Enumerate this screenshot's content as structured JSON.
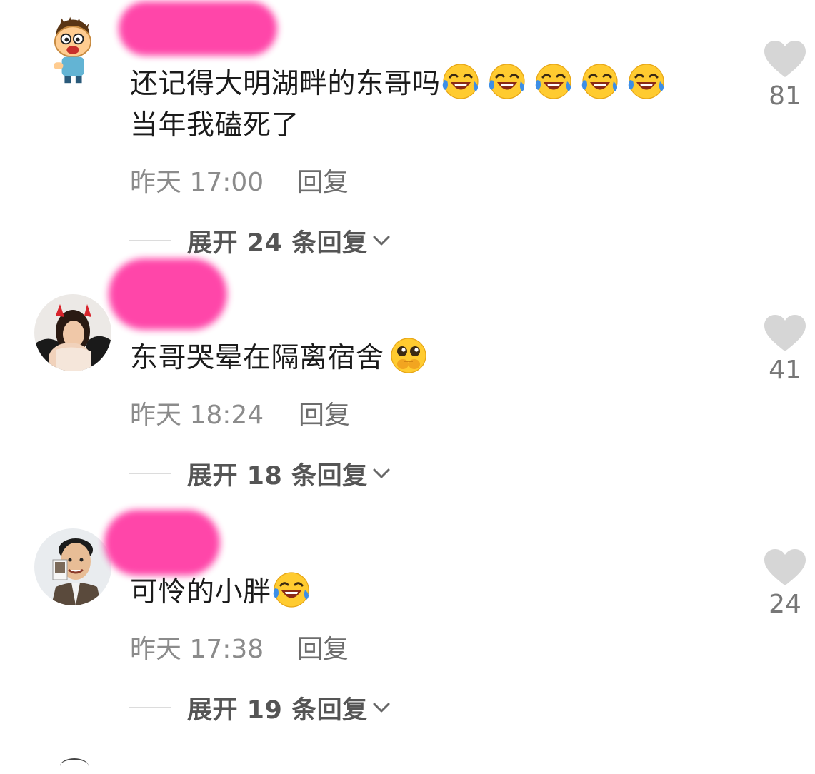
{
  "comments": [
    {
      "text_line1": "还记得大明湖畔的东哥吗",
      "text_line2": "当年我磕死了",
      "emoji": [
        "laugh-cry-emoji",
        "laugh-cry-emoji",
        "laugh-cry-emoji",
        "laugh-cry-emoji",
        "laugh-cry-emoji"
      ],
      "time": "昨天 17:00",
      "reply": "回复",
      "expand": "展开 24 条回复",
      "likes": "81"
    },
    {
      "text_line1": "东哥哭晕在隔离宿舍",
      "emoji": [
        "pleading-hands-emoji"
      ],
      "time": "昨天 18:24",
      "reply": "回复",
      "expand": "展开 18 条回复",
      "likes": "41"
    },
    {
      "text_line1": "可怜的小胖",
      "emoji": [
        "laugh-cry-emoji"
      ],
      "time": "昨天 17:38",
      "reply": "回复",
      "expand": "展开 19 条回复",
      "likes": "24"
    }
  ],
  "icons": {
    "like": "heart-icon",
    "expand": "chevron-down-icon"
  },
  "colors": {
    "redaction": "#ff3fa6",
    "heart": "#d6d6d6",
    "meta_text": "#8b8b8b"
  }
}
